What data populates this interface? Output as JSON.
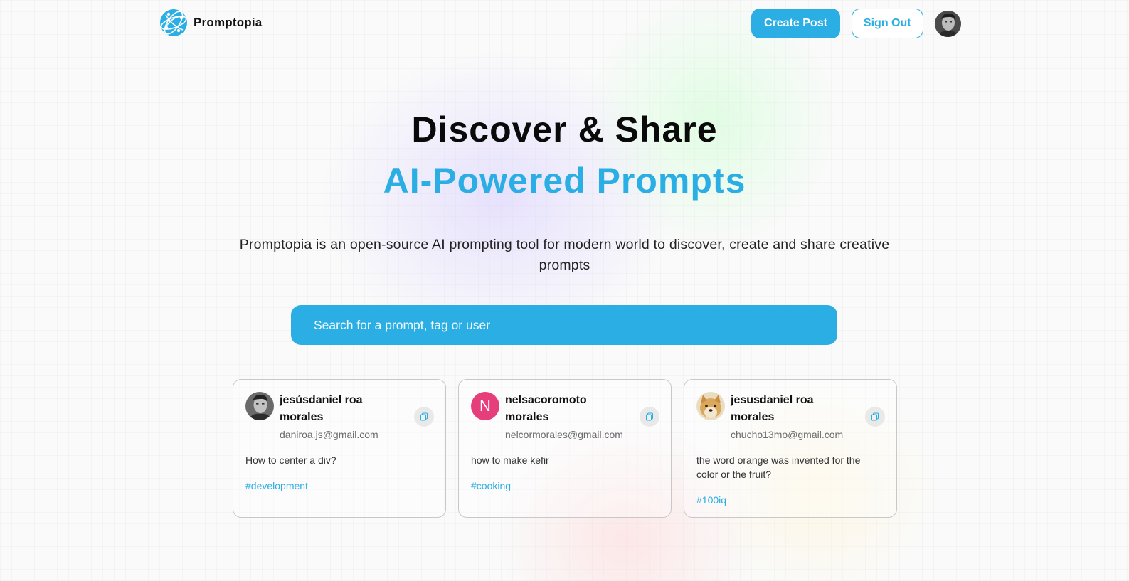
{
  "brand": {
    "name": "Promptopia",
    "accent_color": "#2aaee3"
  },
  "nav": {
    "create_post_label": "Create Post",
    "sign_out_label": "Sign Out"
  },
  "hero": {
    "title": "Discover & Share",
    "subtitle": "AI-Powered Prompts",
    "description": "Promptopia is an open-source AI prompting tool for modern world to discover, create and share creative prompts"
  },
  "search": {
    "placeholder": "Search for a prompt, tag or user",
    "value": ""
  },
  "prompts": [
    {
      "username": "jesúsdaniel roa morales",
      "email": "daniroa.js@gmail.com",
      "avatar": "photo-portrait",
      "prompt": "How to center a div?",
      "tag": "#development"
    },
    {
      "username": "nelsacoromoto morales",
      "email": "nelcormorales@gmail.com",
      "avatar": "letter-avatar",
      "avatar_letter": "N",
      "avatar_color": "#e63e7a",
      "prompt": "how to make kefir",
      "tag": "#cooking"
    },
    {
      "username": "jesusdaniel roa morales",
      "email": "chucho13mo@gmail.com",
      "avatar": "doge-photo",
      "prompt": "the word orange was invented for the color or the fruit?",
      "tag": "#100iq"
    }
  ]
}
